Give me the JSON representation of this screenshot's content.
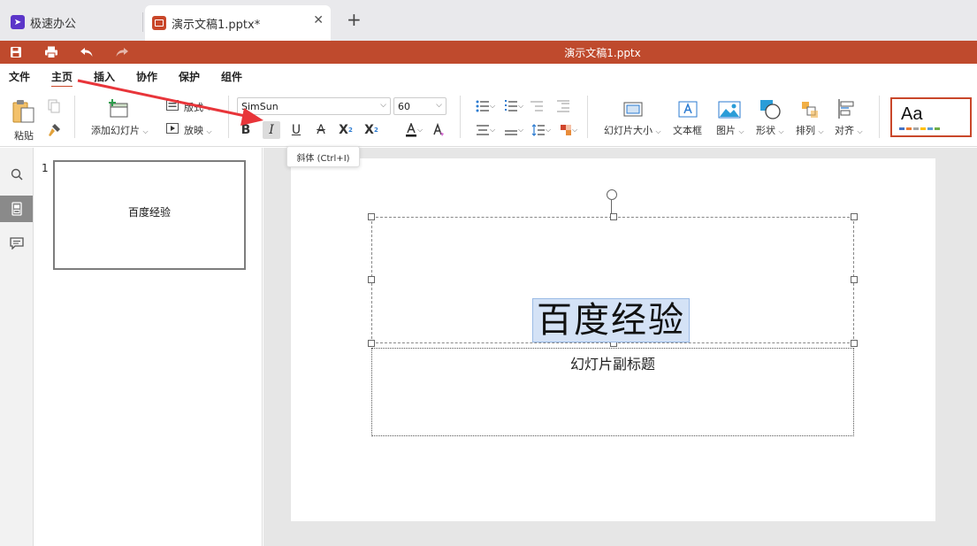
{
  "tabs": {
    "home_label": "极速办公",
    "doc_label": "演示文稿1.pptx*",
    "close_glyph": "✕",
    "add_glyph": "+"
  },
  "titlebar": {
    "doc_title": "演示文稿1.pptx",
    "bg_color": "#bf4a2d"
  },
  "menu": {
    "items": [
      "文件",
      "主页",
      "插入",
      "协作",
      "保护",
      "组件"
    ],
    "active": "主页"
  },
  "ribbon": {
    "paste": "粘贴",
    "add_slide": "添加幻灯片",
    "layout": "版式",
    "play": "放映",
    "font_name": "SimSun",
    "font_size": "60",
    "bold": "B",
    "italic": "I",
    "underline": "U",
    "strike": "A",
    "superscript": "X",
    "subscript": "X",
    "slide_size": "幻灯片大小",
    "textbox": "文本框",
    "picture": "图片",
    "shape": "形状",
    "arrange": "排列",
    "align": "对齐",
    "theme_sample": "Aa"
  },
  "tooltip": "斜体 (Ctrl+I)",
  "thumbnails": [
    {
      "number": "1",
      "text": "百度经验"
    }
  ],
  "slide": {
    "title": "百度经验",
    "subtitle": "幻灯片副标题"
  },
  "colors": {
    "accent": "#c9472a",
    "selection": "#d4e2f6",
    "arrow": "#e8353a"
  }
}
